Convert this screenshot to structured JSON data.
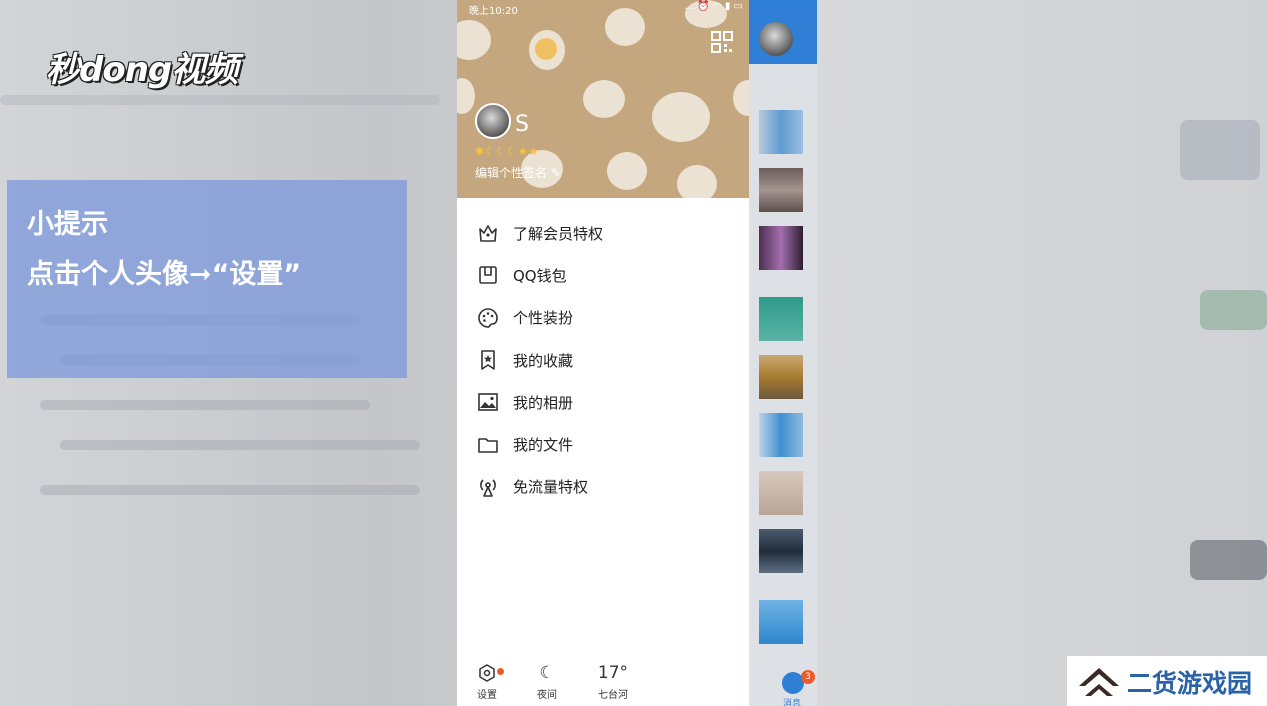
{
  "brand": {
    "video_logo": "秒dong视频"
  },
  "tip": {
    "title": "小提示",
    "body": "点击个人头像➞“设置”"
  },
  "status_bar": {
    "time": "晚上10:20",
    "icons": "... ⏰ ◠ ▮ ▭"
  },
  "profile": {
    "username": "S",
    "level_icons": "✺☾☾☾★★",
    "signature_prompt": "编辑个性签名"
  },
  "menu": {
    "items": [
      {
        "label": "了解会员特权",
        "icon": "crown-icon"
      },
      {
        "label": "QQ钱包",
        "icon": "wallet-icon"
      },
      {
        "label": "个性装扮",
        "icon": "palette-icon"
      },
      {
        "label": "我的收藏",
        "icon": "bookmark-star-icon"
      },
      {
        "label": "我的相册",
        "icon": "photo-icon"
      },
      {
        "label": "我的文件",
        "icon": "folder-icon"
      },
      {
        "label": "免流量特权",
        "icon": "antenna-icon"
      }
    ]
  },
  "footer": {
    "settings_label": "设置",
    "night_label": "夜间",
    "temperature": "17°",
    "location": "七台河"
  },
  "conversation_strip": {
    "unread_badge": "3",
    "tab_label": "消息"
  },
  "watermark": {
    "text": "二货游戏园"
  },
  "colors": {
    "header_tan": "#c4a67f",
    "tip_overlay": "#7896dc",
    "qq_blue": "#2f7fd6",
    "badge_red": "#f05a2a",
    "level_gold": "#f6c63b",
    "watermark_blue": "#2b63a8"
  }
}
